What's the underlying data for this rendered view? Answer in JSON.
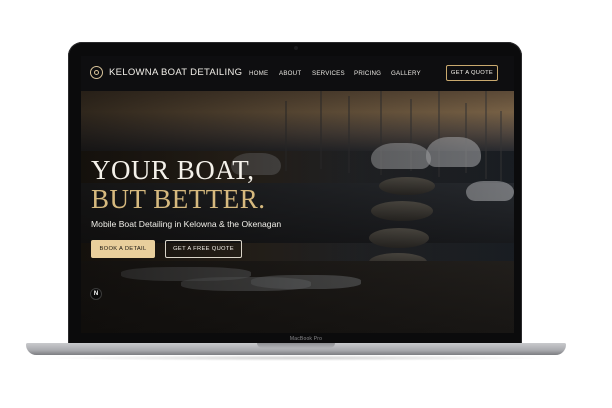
{
  "device": {
    "model_label": "MacBook Pro"
  },
  "site": {
    "brand": "KELOWNA BOAT DETAILING",
    "logo_icon": "compass-ring-icon"
  },
  "nav": {
    "items": [
      {
        "label": "HOME"
      },
      {
        "label": "ABOUT"
      },
      {
        "label": "SERVICES"
      },
      {
        "label": "PRICING"
      },
      {
        "label": "GALLERY"
      }
    ],
    "cta": "GET A QUOTE"
  },
  "hero": {
    "headline_line1": "YOUR BOAT,",
    "headline_line2": "BUT BETTER.",
    "subtitle": "Mobile Boat Detailing in Kelowna & the Okenagan",
    "primary_button": "BOOK A DETAIL",
    "secondary_button": "GET A FREE QUOTE",
    "badge_letter": "N"
  },
  "colors": {
    "accent_gold": "#d6b97e",
    "button_gold": "#e9cf9c",
    "nav_bg": "#0e0e10"
  }
}
